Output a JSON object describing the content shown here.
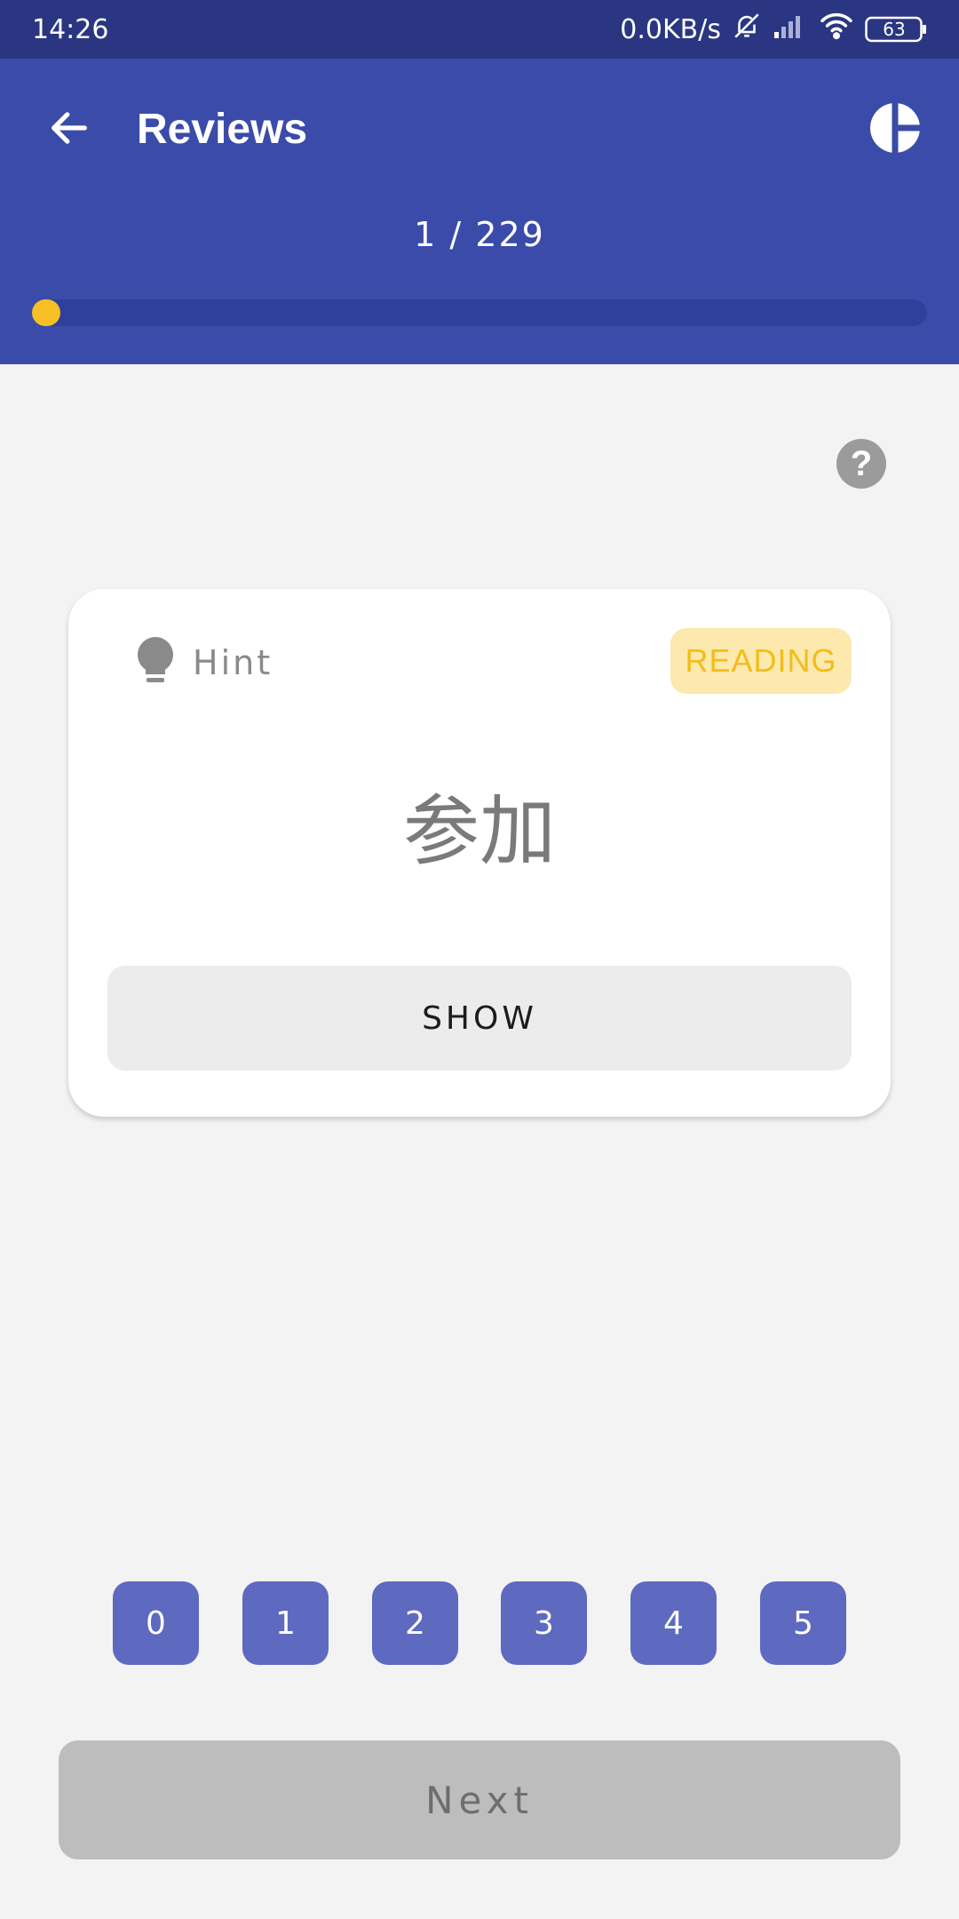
{
  "status_bar": {
    "time": "14:26",
    "net_speed": "0.0KB/s",
    "battery": "63",
    "icons": [
      "bell-off-icon",
      "signal-icon",
      "wifi-icon",
      "battery-icon"
    ]
  },
  "app_bar": {
    "title": "Reviews",
    "back_icon": "arrow-left-icon",
    "stats_icon": "pie-chart-icon",
    "counter": "1 / 229",
    "progress_fraction": 0.004
  },
  "card": {
    "hint_label": "Hint",
    "hint_icon": "lightbulb-icon",
    "badge": "READING",
    "kanji": "参加",
    "show_label": "SHOW"
  },
  "help_icon": "question-icon",
  "grades": [
    "0",
    "1",
    "2",
    "3",
    "4",
    "5"
  ],
  "next_label": "Next",
  "colors": {
    "status_bar": "#2a3681",
    "primary": "#3a4baa",
    "accent": "#f6c026",
    "grade_button": "#5e69c0",
    "badge_bg": "#fde9ad",
    "badge_text": "#f2bd1a"
  }
}
